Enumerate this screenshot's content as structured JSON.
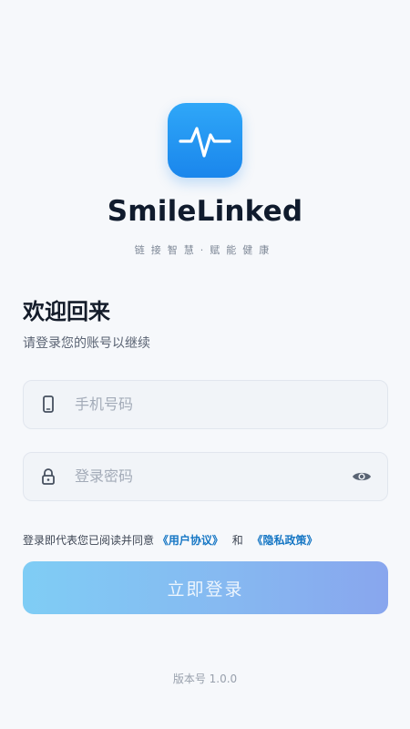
{
  "app": {
    "name": "SmileLinked",
    "tagline": "链接智慧·赋能健康",
    "logo_icon": "pulse-wave-icon"
  },
  "welcome": {
    "title": "欢迎回来",
    "subtitle": "请登录您的账号以继续"
  },
  "form": {
    "phone": {
      "placeholder": "手机号码",
      "value": "",
      "icon": "phone-icon"
    },
    "password": {
      "placeholder": "登录密码",
      "value": "",
      "icon": "lock-icon",
      "toggle_icon": "eye-icon"
    }
  },
  "agreement": {
    "prefix": "登录即代表您已阅读并同意",
    "user_agreement": "《用户协议》",
    "conjunction": "和",
    "privacy_policy": "《隐私政策》"
  },
  "login_button": {
    "label": "立即登录"
  },
  "footer": {
    "version": "版本号 1.0.0"
  },
  "colors": {
    "background": "#f6f8fb",
    "logo_gradient_top": "#2fa7f8",
    "logo_gradient_bottom": "#1a86ec",
    "link": "#1576c4",
    "button_gradient_start": "#7fcdf5",
    "button_gradient_end": "#88a6ee"
  }
}
